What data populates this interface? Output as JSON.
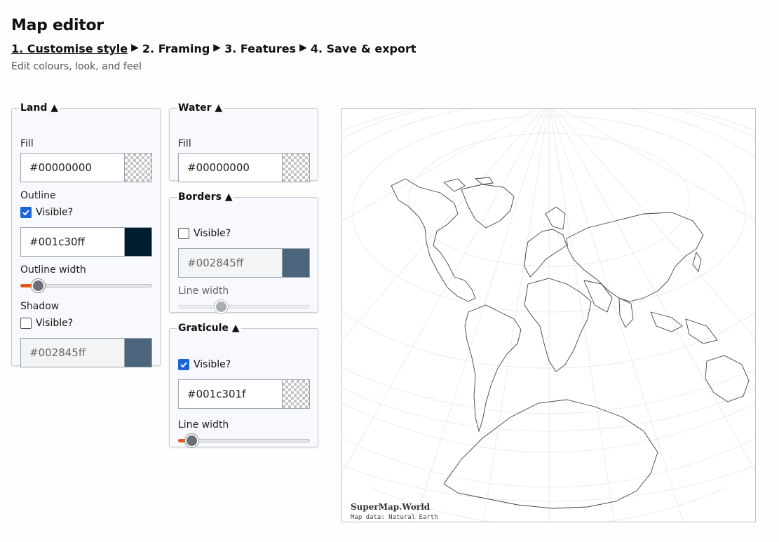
{
  "header": {
    "title": "Map editor",
    "steps": [
      "1. Customise style",
      "2. Framing",
      "3. Features",
      "4. Save & export"
    ],
    "separator": "▶",
    "subtitle": "Edit colours, look, and feel"
  },
  "land": {
    "legend": "Land ▲",
    "fill_label": "Fill",
    "fill_value": "#00000000",
    "outline_label": "Outline",
    "outline_visible_label": "Visible?",
    "outline_visible": true,
    "outline_color": "#001c30ff",
    "outline_width_label": "Outline width",
    "outline_width_fraction": 0.14,
    "shadow_label": "Shadow",
    "shadow_visible_label": "Visible?",
    "shadow_visible": false,
    "shadow_color": "#002845ff"
  },
  "water": {
    "legend": "Water ▲",
    "fill_label": "Fill",
    "fill_value": "#00000000"
  },
  "borders": {
    "legend": "Borders ▲",
    "visible_label": "Visible?",
    "visible": false,
    "color": "#002845ff",
    "line_width_label": "Line width",
    "line_width_fraction": 0.33
  },
  "graticule": {
    "legend": "Graticule ▲",
    "visible_label": "Visible?",
    "visible": true,
    "color": "#001c301f",
    "line_width_label": "Line width",
    "line_width_fraction": 0.11
  },
  "map": {
    "attribution_brand": "SuperMap.World",
    "attribution_data": "Map data: Natural Earth"
  },
  "colors": {
    "accent": "#e05a1e",
    "checkbox": "#1a63d8",
    "outline_swatch": "#001c30",
    "borders_swatch": "#4a657c"
  }
}
